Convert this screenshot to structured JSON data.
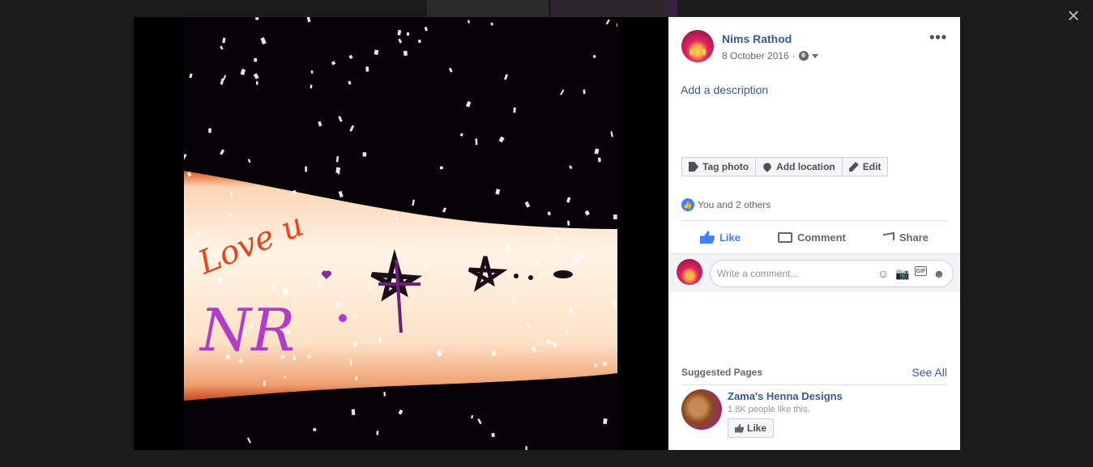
{
  "close_label": "×",
  "post": {
    "author": "Nims Rathod",
    "date": "8 October 2016",
    "date_separator": "·",
    "privacy_icon": "globe-icon",
    "more_label": "•••",
    "add_description": "Add a description"
  },
  "photo": {
    "caption_text": "Love u",
    "initials_text": "NR",
    "palette": {
      "skin": "#fde9d2",
      "edge": "#e0551b",
      "ink": "#1a0d18",
      "glitter": "#b23cc8",
      "red_text": "#e8451b"
    }
  },
  "actions": {
    "tag_photo": "Tag photo",
    "add_location": "Add location",
    "edit": "Edit"
  },
  "reactions": {
    "summary": "You and 2 others"
  },
  "ufi": {
    "like": "Like",
    "comment": "Comment",
    "share": "Share"
  },
  "comment_box": {
    "placeholder": "Write a comment...",
    "icons": [
      "emoji-icon",
      "camera-icon",
      "gif-icon",
      "sticker-icon"
    ]
  },
  "suggested": {
    "title": "Suggested Pages",
    "see_all": "See All",
    "items": [
      {
        "name": "Zama's Henna Designs",
        "likes": "1.8K people like this.",
        "like_button": "Like"
      }
    ]
  },
  "colors": {
    "link": "#385898",
    "accent": "#4080ff",
    "overlay": "#1b1b1b"
  }
}
